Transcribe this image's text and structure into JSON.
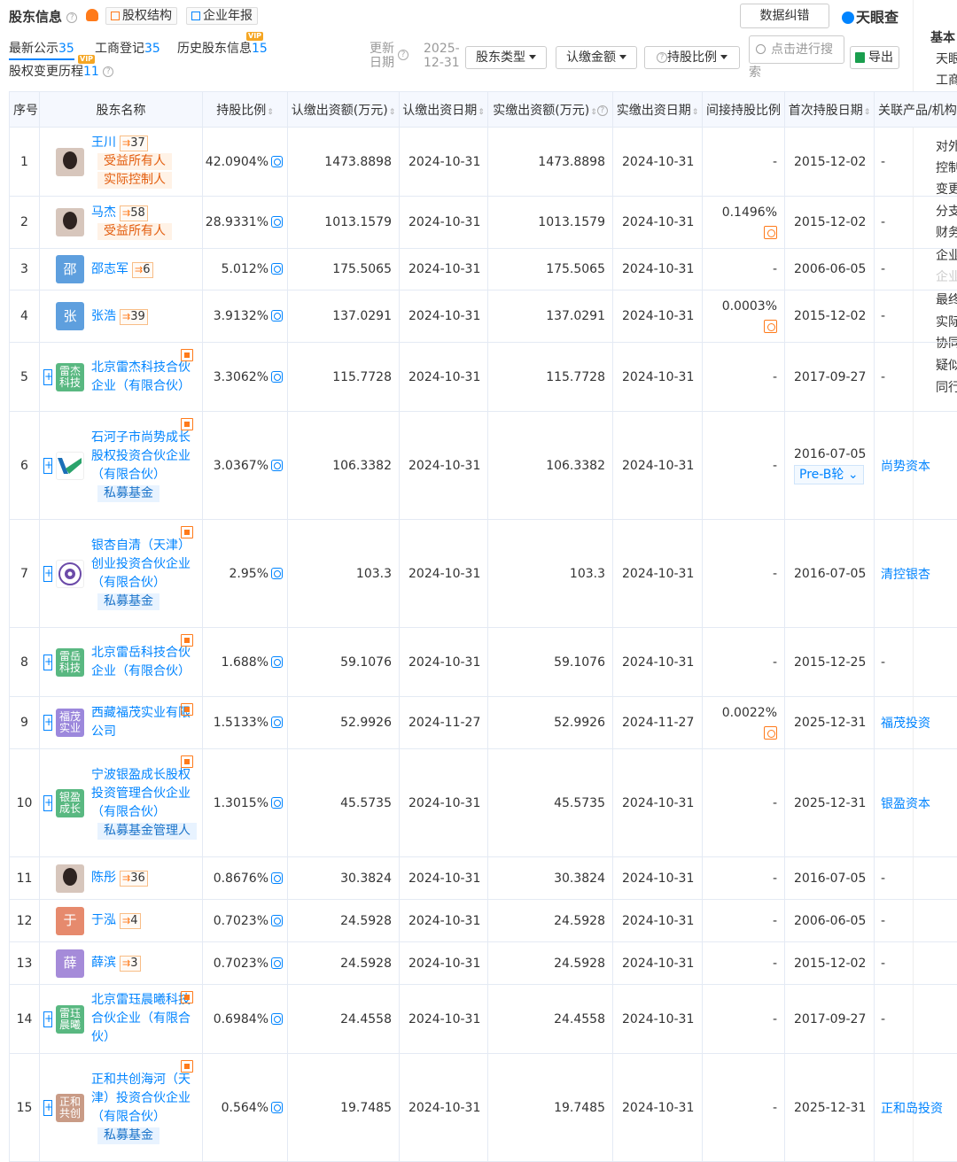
{
  "header": {
    "title": "股东信息",
    "equity_structure": "股权结构",
    "annual_report": "企业年报",
    "correct_btn": "数据纠错",
    "logo": "天眼查"
  },
  "tabs": [
    {
      "label": "最新公示",
      "count": "35"
    },
    {
      "label": "工商登记",
      "count": "35"
    },
    {
      "label": "历史股东信息",
      "count": "15",
      "vip": "VIP"
    },
    {
      "label": "股权变更历程",
      "count": "11",
      "vip": "VIP"
    }
  ],
  "controls": {
    "update_label": "更新日期",
    "update_date": "2025-12-31",
    "shareholder_type": "股东类型",
    "subscribed_amount": "认缴金额",
    "holding_ratio": "持股比例",
    "search_placeholder": "点击进行搜",
    "search_wrap": "索",
    "export": "导出"
  },
  "columns": [
    "序号",
    "股东名称",
    "持股比例",
    "认缴出资额(万元)",
    "认缴出资日期",
    "实缴出资额(万元)",
    "实缴出资日期",
    "间接持股比例",
    "首次持股日期",
    "关联产品/机构"
  ],
  "rows": [
    {
      "no": "1",
      "name": "王川",
      "count": "37",
      "avatar": "photo",
      "avatar_text": "",
      "tags": [
        "受益所有人",
        "实际控制人"
      ],
      "ratio": "42.0904%",
      "sub_amt": "1473.8898",
      "sub_date": "2024-10-31",
      "paid_amt": "1473.8898",
      "paid_date": "2024-10-31",
      "indirect": "-",
      "first_date": "2015-12-02",
      "related": "-"
    },
    {
      "no": "2",
      "name": "马杰",
      "count": "58",
      "avatar": "photo",
      "avatar_text": "",
      "tags": [
        "受益所有人"
      ],
      "ratio": "28.9331%",
      "sub_amt": "1013.1579",
      "sub_date": "2024-10-31",
      "paid_amt": "1013.1579",
      "paid_date": "2024-10-31",
      "indirect": "0.1496%",
      "first_date": "2015-12-02",
      "related": "-"
    },
    {
      "no": "3",
      "name": "邵志军",
      "count": "6",
      "avatar": "blue",
      "avatar_text": "邵",
      "tags": [],
      "ratio": "5.012%",
      "sub_amt": "175.5065",
      "sub_date": "2024-10-31",
      "paid_amt": "175.5065",
      "paid_date": "2024-10-31",
      "indirect": "-",
      "first_date": "2006-06-05",
      "related": "-"
    },
    {
      "no": "4",
      "name": "张浩",
      "count": "39",
      "avatar": "blue",
      "avatar_text": "张",
      "tags": [],
      "ratio": "3.9132%",
      "sub_amt": "137.0291",
      "sub_date": "2024-10-31",
      "paid_amt": "137.0291",
      "paid_date": "2024-10-31",
      "indirect": "0.0003%",
      "first_date": "2015-12-02",
      "related": "-"
    },
    {
      "no": "5",
      "name": "北京雷杰科技合伙企业（有限合伙）",
      "count": "",
      "avatar": "green",
      "avatar_text": "雷杰科技",
      "ent": true,
      "tags": [],
      "ratio": "3.3062%",
      "sub_amt": "115.7728",
      "sub_date": "2024-10-31",
      "paid_amt": "115.7728",
      "paid_date": "2024-10-31",
      "indirect": "-",
      "first_date": "2017-09-27",
      "related": "-"
    },
    {
      "no": "6",
      "name": "石河子市尚势成长股权投资合伙企业（有限合伙）",
      "count": "",
      "avatar": "logo",
      "avatar_text": "",
      "ent": true,
      "tags_b": [
        "私募基金"
      ],
      "tags": [],
      "ratio": "3.0367%",
      "sub_amt": "106.3382",
      "sub_date": "2024-10-31",
      "paid_amt": "106.3382",
      "paid_date": "2024-10-31",
      "indirect": "-",
      "first_date": "2016-07-05",
      "round": "Pre-B轮",
      "related": "尚势资本"
    },
    {
      "no": "7",
      "name": "银杏自清（天津）创业投资合伙企业（有限合伙）",
      "count": "",
      "avatar": "logo2",
      "avatar_text": "",
      "ent": true,
      "tags_b": [
        "私募基金"
      ],
      "tags": [],
      "ratio": "2.95%",
      "sub_amt": "103.3",
      "sub_date": "2024-10-31",
      "paid_amt": "103.3",
      "paid_date": "2024-10-31",
      "indirect": "-",
      "first_date": "2016-07-05",
      "related": "清控银杏"
    },
    {
      "no": "8",
      "name": "北京雷岳科技合伙企业（有限合伙）",
      "count": "",
      "avatar": "green",
      "avatar_text": "雷岳科技",
      "ent": true,
      "tags": [],
      "ratio": "1.688%",
      "sub_amt": "59.1076",
      "sub_date": "2024-10-31",
      "paid_amt": "59.1076",
      "paid_date": "2024-10-31",
      "indirect": "-",
      "first_date": "2015-12-25",
      "related": "-"
    },
    {
      "no": "9",
      "name": "西藏福茂实业有限公司",
      "count": "",
      "avatar": "purple",
      "avatar_text": "福茂实业",
      "ent": true,
      "tags": [],
      "ratio": "1.5133%",
      "sub_amt": "52.9926",
      "sub_date": "2024-11-27",
      "paid_amt": "52.9926",
      "paid_date": "2024-11-27",
      "indirect": "0.0022%",
      "first_date": "2025-12-31",
      "related": "福茂投资"
    },
    {
      "no": "10",
      "name": "宁波银盈成长股权投资管理合伙企业（有限合伙）",
      "count": "",
      "avatar": "green",
      "avatar_text": "银盈成长",
      "ent": true,
      "tags_b": [
        "私募基金管理人"
      ],
      "tags": [],
      "ratio": "1.3015%",
      "sub_amt": "45.5735",
      "sub_date": "2024-10-31",
      "paid_amt": "45.5735",
      "paid_date": "2024-10-31",
      "indirect": "-",
      "first_date": "2025-12-31",
      "related": "银盈资本"
    },
    {
      "no": "11",
      "name": "陈彤",
      "count": "36",
      "avatar": "photo",
      "avatar_text": "",
      "tags": [],
      "ratio": "0.8676%",
      "sub_amt": "30.3824",
      "sub_date": "2024-10-31",
      "paid_amt": "30.3824",
      "paid_date": "2024-10-31",
      "indirect": "-",
      "first_date": "2016-07-05",
      "related": "-"
    },
    {
      "no": "12",
      "name": "于泓",
      "count": "4",
      "avatar": "red",
      "avatar_text": "于",
      "tags": [],
      "ratio": "0.7023%",
      "sub_amt": "24.5928",
      "sub_date": "2024-10-31",
      "paid_amt": "24.5928",
      "paid_date": "2024-10-31",
      "indirect": "-",
      "first_date": "2006-06-05",
      "related": "-"
    },
    {
      "no": "13",
      "name": "薛滨",
      "count": "3",
      "avatar": "violet",
      "avatar_text": "薛",
      "tags": [],
      "ratio": "0.7023%",
      "sub_amt": "24.5928",
      "sub_date": "2024-10-31",
      "paid_amt": "24.5928",
      "paid_date": "2024-10-31",
      "indirect": "-",
      "first_date": "2015-12-02",
      "related": "-"
    },
    {
      "no": "14",
      "name": "北京雷珏晨曦科技合伙企业（有限合伙）",
      "count": "",
      "avatar": "green",
      "avatar_text": "雷珏晨曦",
      "ent": true,
      "tags": [],
      "ratio": "0.6984%",
      "sub_amt": "24.4558",
      "sub_date": "2024-10-31",
      "paid_amt": "24.4558",
      "paid_date": "2024-10-31",
      "indirect": "-",
      "first_date": "2017-09-27",
      "related": "-"
    },
    {
      "no": "15",
      "name": "正和共创海河（天津）投资合伙企业（有限合伙）",
      "count": "",
      "avatar": "tan",
      "avatar_text": "正和共创",
      "ent": true,
      "tags_b": [
        "私募基金"
      ],
      "tags": [],
      "ratio": "0.564%",
      "sub_amt": "19.7485",
      "sub_date": "2024-10-31",
      "paid_amt": "19.7485",
      "paid_date": "2024-10-31",
      "indirect": "-",
      "first_date": "2025-12-31",
      "related": "正和岛投资"
    }
  ],
  "side": [
    {
      "t": "基本",
      "bold": true
    },
    {
      "t": "天眼"
    },
    {
      "t": "工商"
    },
    {
      "t": "对外"
    },
    {
      "t": "控制"
    },
    {
      "t": "变更"
    },
    {
      "t": "分支"
    },
    {
      "t": "财务"
    },
    {
      "t": "企业"
    },
    {
      "t": "企业",
      "gray": true
    },
    {
      "t": "最终"
    },
    {
      "t": "实际"
    },
    {
      "t": "协同"
    },
    {
      "t": "疑似"
    },
    {
      "t": "同行"
    }
  ]
}
